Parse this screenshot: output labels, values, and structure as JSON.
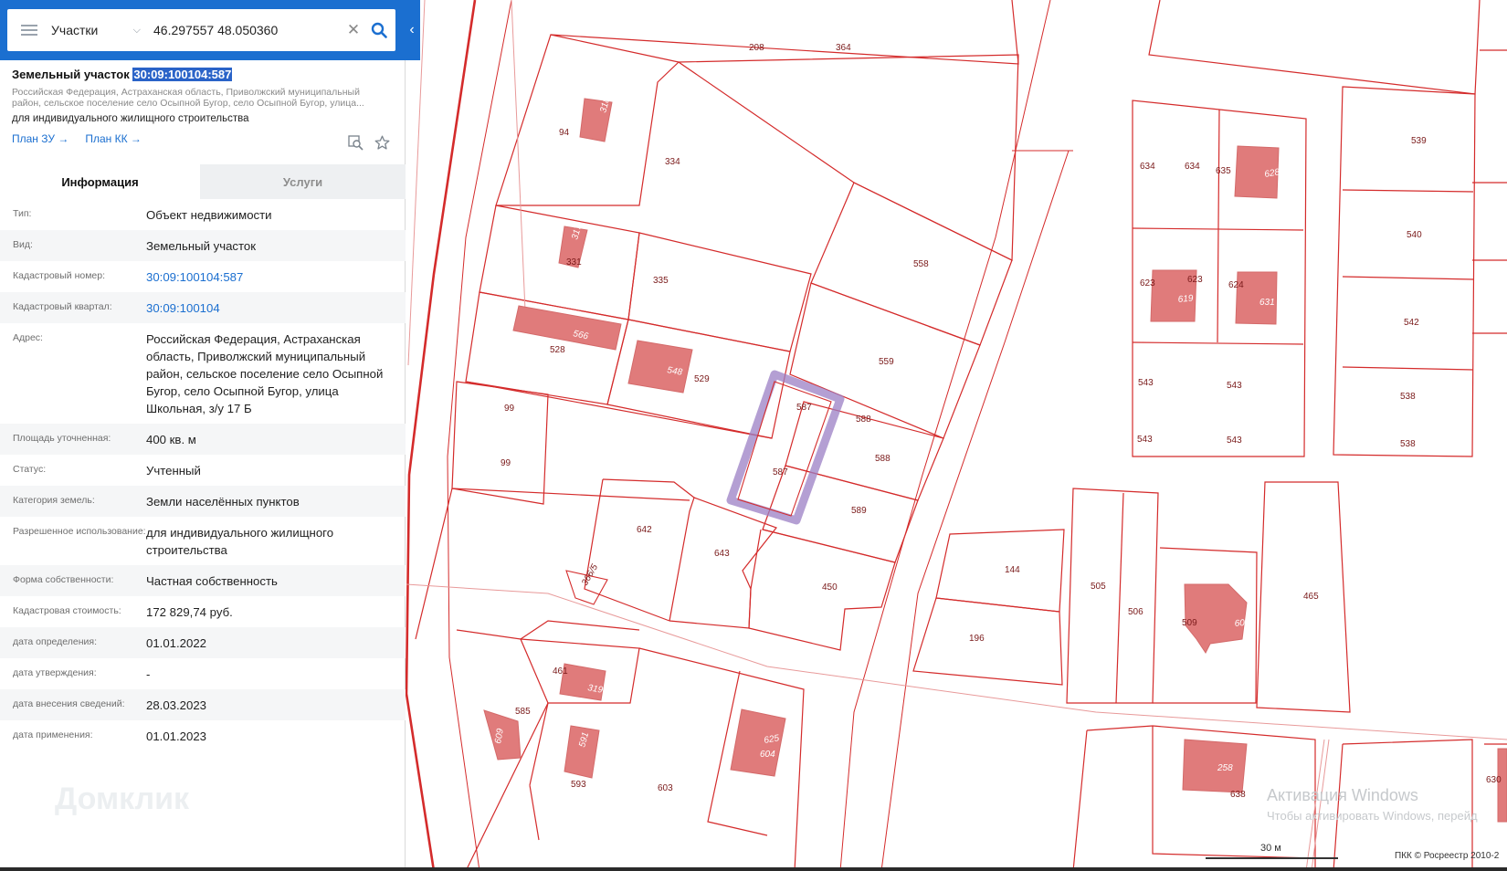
{
  "search": {
    "category": "Участки",
    "query": "46.297557 48.050360"
  },
  "parcel": {
    "title_prefix": "Земельный участок",
    "cad_number": "30:09:100104:587",
    "address_short": "Российская Федерация, Астраханская область, Приволжский муниципальный район, сельское поселение село Осыпной Бугор, село Осыпной Бугор, улица...",
    "use": "для индивидуального жилищного строительства",
    "link_plan_zu": "План ЗУ →",
    "link_plan_kk": "План КК →"
  },
  "tabs": {
    "info": "Информация",
    "services": "Услуги"
  },
  "properties": [
    {
      "key": "Тип:",
      "value": "Объект недвижимости"
    },
    {
      "key": "Вид:",
      "value": "Земельный участок"
    },
    {
      "key": "Кадастровый номер:",
      "value": "30:09:100104:587"
    },
    {
      "key": "Кадастровый квартал:",
      "value": "30:09:100104"
    },
    {
      "key": "Адрес:",
      "value": "Российская Федерация, Астраханская область, Приволжский муниципальный район, сельское поселение село Осыпной Бугор, село Осыпной Бугор, улица Школьная, з/у 17 Б"
    },
    {
      "key": "Площадь уточненная:",
      "value": "400 кв. м"
    },
    {
      "key": "Статус:",
      "value": "Учтенный"
    },
    {
      "key": "Категория земель:",
      "value": "Земли населённых пунктов"
    },
    {
      "key": "Разрешенное использование:",
      "value": "для индивидуального жилищного строительства"
    },
    {
      "key": "Форма собственности:",
      "value": "Частная собственность"
    },
    {
      "key": "Кадастровая стоимость:",
      "value": "172 829,74 руб."
    },
    {
      "key": "дата определения:",
      "value": "01.01.2022"
    },
    {
      "key": "дата утверждения:",
      "value": "-"
    },
    {
      "key": "дата внесения сведений:",
      "value": "28.03.2023"
    },
    {
      "key": "дата применения:",
      "value": "01.01.2023"
    }
  ],
  "watermark": "Домклик",
  "map": {
    "parcel_labels": [
      "208",
      "364",
      "94",
      "334",
      "331",
      "335",
      "558",
      "528",
      "529",
      "559",
      "99",
      "99",
      "587",
      "588",
      "587",
      "588",
      "642",
      "643",
      "589",
      "450",
      "539",
      "634",
      "634",
      "635",
      "540",
      "542",
      "623",
      "623",
      "624",
      "543",
      "543",
      "538",
      "543",
      "543",
      "538",
      "144",
      "505",
      "506",
      "509",
      "465",
      "196",
      "461",
      "585",
      "593",
      "603",
      "638",
      "630"
    ],
    "building_labels": [
      "318",
      "317",
      "566",
      "548",
      "628",
      "619",
      "631",
      "366/5",
      "605",
      "319",
      "609",
      "591",
      "625",
      "604",
      "258"
    ],
    "colors": {
      "lines": "#d42b2b",
      "buildings": "#e07b7b",
      "highlight": "#9b7fc4"
    }
  },
  "activation": {
    "title": "Активация Windows",
    "subtitle": "Чтобы активировать Windows, перейд"
  },
  "scale": "30 м",
  "copyright": "ПКК © Росреестр 2010-2"
}
